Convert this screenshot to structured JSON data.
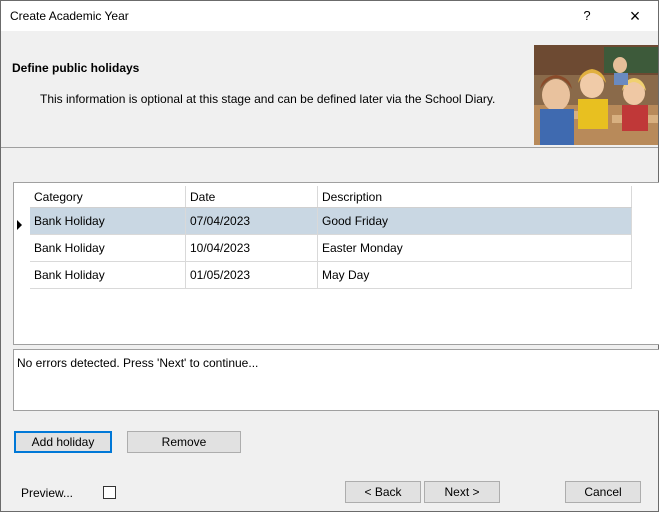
{
  "window": {
    "title": "Create Academic Year",
    "help_label": "?",
    "close_label": "×"
  },
  "header": {
    "title": "Define public holidays",
    "description": "This information is optional at this stage and can be defined later via the School Diary."
  },
  "holidays_grid": {
    "columns": [
      "Category",
      "Date",
      "Description"
    ],
    "rows": [
      {
        "category": "Bank Holiday",
        "date": "07/04/2023",
        "description": "Good Friday",
        "selected": true
      },
      {
        "category": "Bank Holiday",
        "date": "10/04/2023",
        "description": "Easter Monday",
        "selected": false
      },
      {
        "category": "Bank Holiday",
        "date": "01/05/2023",
        "description": "May Day",
        "selected": false
      }
    ]
  },
  "messages": {
    "text": "No errors detected. Press 'Next' to continue..."
  },
  "grid_actions": {
    "add_label": "Add holiday",
    "remove_label": "Remove"
  },
  "footer": {
    "preview_label": "Preview...",
    "preview_checked": false,
    "back_label": "< Back",
    "next_label": "Next >",
    "cancel_label": "Cancel"
  },
  "colors": {
    "selection_row": "#c9d7e3",
    "focus_border": "#0078d7",
    "dialog_background": "#f0f0f0"
  },
  "icons": [
    "help-icon",
    "close-icon",
    "row-pointer-icon",
    "classroom-photo"
  ]
}
